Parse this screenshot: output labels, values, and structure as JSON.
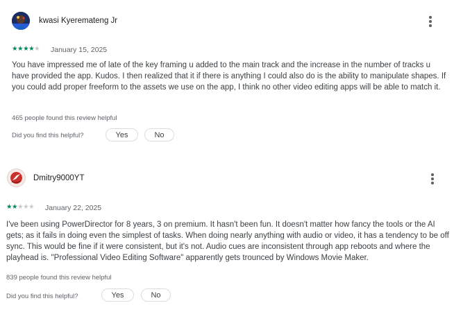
{
  "reviews": [
    {
      "author": "kwasi Kyeremateng Jr",
      "rating": 4,
      "max_rating": 5,
      "date": "January 15, 2025",
      "text": "You have impressed me of late of the key framing u added to the main track and the increase in the number of tracks u have provided the app. Kudos. I then realized that it if there is anything I could also do is the ability to manipulate shapes. If you could add proper freeform to the assets we use on the app, I think no other video editing apps will be able to match it.",
      "helpful_count": "465 people found this review helpful",
      "helpful_question": "Did you find this helpful?",
      "yes_label": "Yes",
      "no_label": "No",
      "star_on_color": "#01875f"
    },
    {
      "author": "Dmitry9000YT",
      "rating": 2,
      "max_rating": 5,
      "date": "January 22, 2025",
      "text": "I've been using PowerDirector for 8 years, 3 on premium. It hasn't been fun. It doesn't matter how fancy the tools or the AI gets; as it fails in doing even the simplest of tasks. When doing nearly anything with audio or video, it has a tendency to be off sync. This would be fine if it were consistent, but it's not. Audio cues are inconsistent through app reboots and where the playhead is. \"Professional Video Editing Software\" apparently gets trounced by Windows Movie Maker.",
      "helpful_count": "839 people found this review helpful",
      "helpful_question": "Did you find this helpful?",
      "yes_label": "Yes",
      "no_label": "No",
      "star_on_color": "#01875f"
    }
  ],
  "icons": {
    "more": "more-vert-icon",
    "star": "star-icon"
  }
}
